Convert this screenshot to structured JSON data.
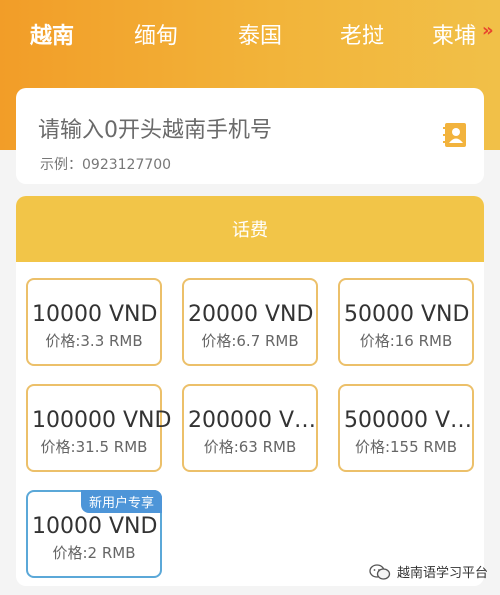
{
  "tabs": [
    {
      "label": "越南",
      "active": true
    },
    {
      "label": "缅甸",
      "active": false
    },
    {
      "label": "泰国",
      "active": false
    },
    {
      "label": "老挝",
      "active": false
    },
    {
      "label": "柬埔",
      "active": false
    }
  ],
  "tab_more_icon": "double-chevron-right",
  "phone": {
    "placeholder": "请输入0开头越南手机号",
    "example": "示例：0923127700",
    "contact_icon": "contact-book-icon"
  },
  "topup": {
    "title": "话费",
    "packages": [
      {
        "amount": "10000 VND",
        "price": "价格:3.3 RMB"
      },
      {
        "amount": "20000 VND",
        "price": "价格:6.7 RMB"
      },
      {
        "amount": "50000 VND",
        "price": "价格:16 RMB"
      },
      {
        "amount": "100000 VND",
        "price": "价格:31.5 RMB"
      },
      {
        "amount": "200000 V…",
        "price": "价格:63 RMB"
      },
      {
        "amount": "500000 V…",
        "price": "价格:155 RMB"
      },
      {
        "amount": "10000 VND",
        "price": "价格:2 RMB",
        "badge": "新用户专享",
        "selected": true
      }
    ]
  },
  "watermark": {
    "text": "越南语学习平台",
    "icon": "wechat-icon"
  },
  "colors": {
    "header_start": "#f29d28",
    "header_end": "#f1c048",
    "topup_header": "#f2c548",
    "package_border": "#ecc06a",
    "selected_border": "#5ba8d8",
    "badge": "#4d95d8",
    "tab_more": "#e8452e"
  }
}
